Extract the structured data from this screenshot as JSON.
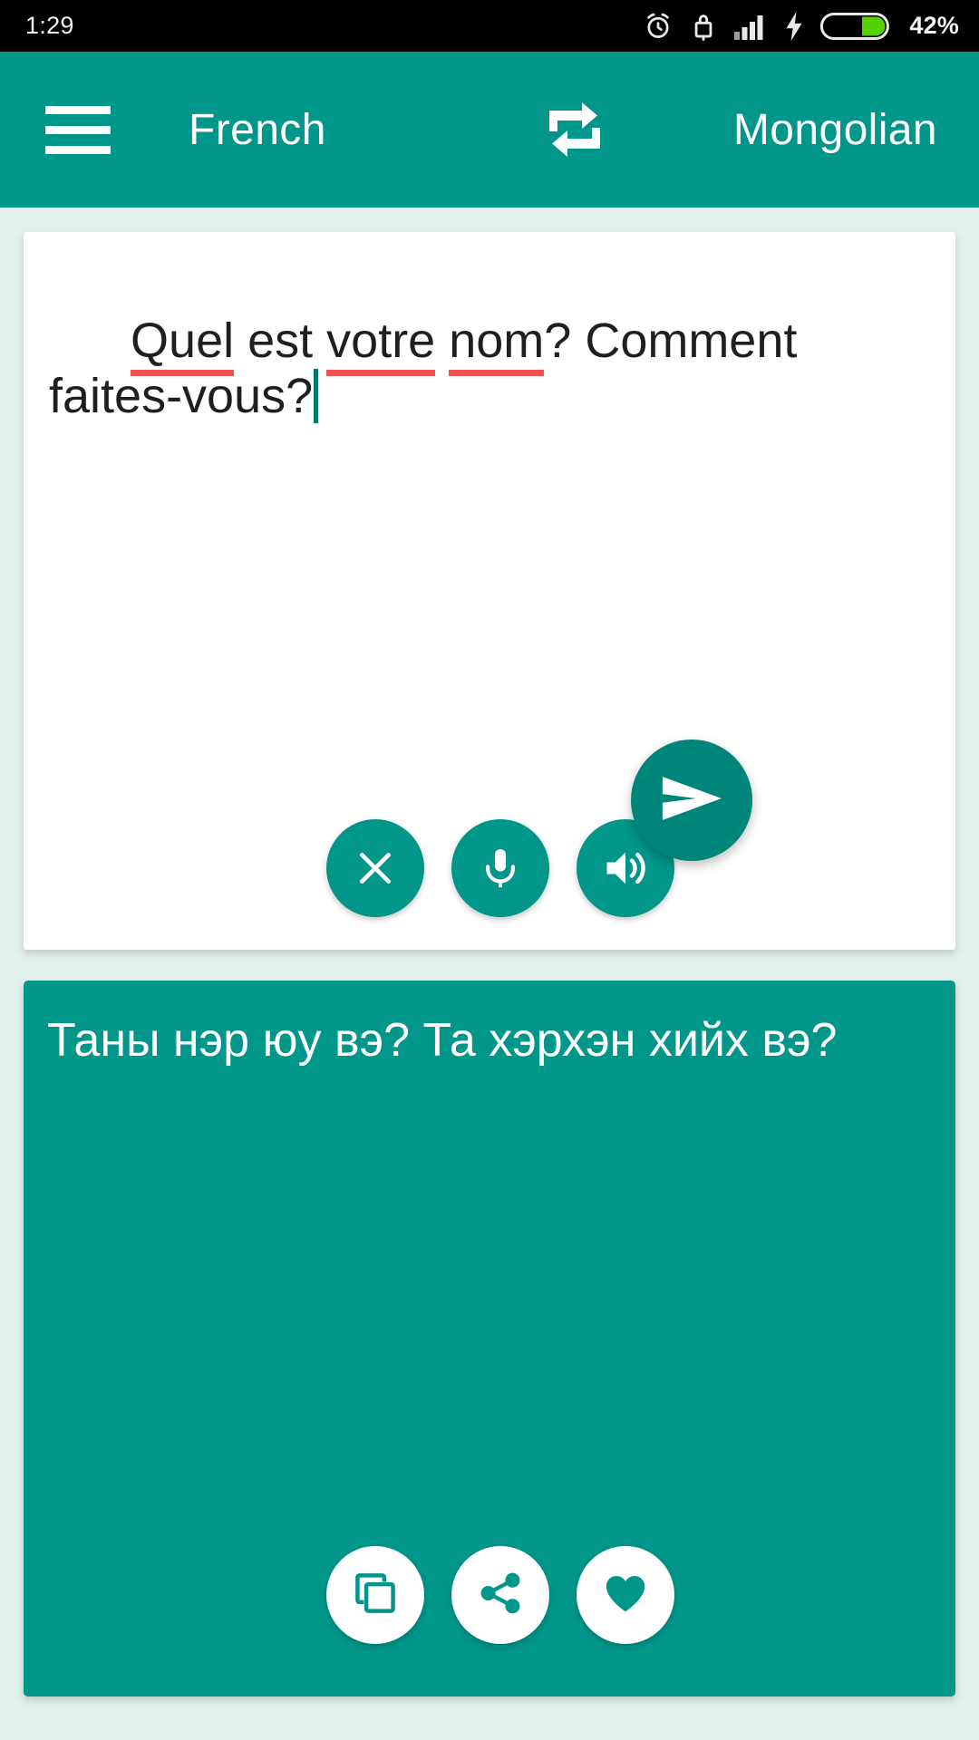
{
  "status_bar": {
    "clock": "1:29",
    "battery_percent": "42%",
    "icons": [
      "alarm-icon",
      "lock-icon",
      "signal-icon",
      "charging-bolt-icon",
      "battery-icon"
    ]
  },
  "app_bar": {
    "menu_icon": "hamburger-menu-icon",
    "source_language": "French",
    "swap_icon": "swap-languages-icon",
    "target_language": "Mongolian"
  },
  "source_card": {
    "text_full": "Quel est votre nom? Comment faites-vous?",
    "segments": [
      {
        "text": "Quel",
        "misspelled": true
      },
      {
        "text": " est ",
        "misspelled": false
      },
      {
        "text": "votre",
        "misspelled": true
      },
      {
        "text": " ",
        "misspelled": false
      },
      {
        "text": "nom",
        "misspelled": true
      },
      {
        "text": "? Comment faites-vous?",
        "misspelled": false
      }
    ],
    "spellcheck_color": "#f3514f",
    "caret_visible": true,
    "buttons": [
      {
        "name": "clear-button",
        "icon": "close-icon"
      },
      {
        "name": "microphone-button",
        "icon": "microphone-icon"
      },
      {
        "name": "speak-source-button",
        "icon": "speaker-icon"
      }
    ]
  },
  "send_button": {
    "name": "send-button",
    "icon": "send-icon"
  },
  "target_card": {
    "text": "Таны нэр юу вэ? Та хэрхэн хийх вэ?",
    "buttons": [
      {
        "name": "copy-button",
        "icon": "copy-icon"
      },
      {
        "name": "share-button",
        "icon": "share-icon"
      },
      {
        "name": "favorite-button",
        "icon": "heart-icon"
      }
    ]
  },
  "colors": {
    "primary": "#00968a",
    "primary_dark": "#00857a",
    "background": "#e2f0ee",
    "card": "#ffffff",
    "status_bar": "#000000",
    "battery_fill": "#56d000"
  }
}
